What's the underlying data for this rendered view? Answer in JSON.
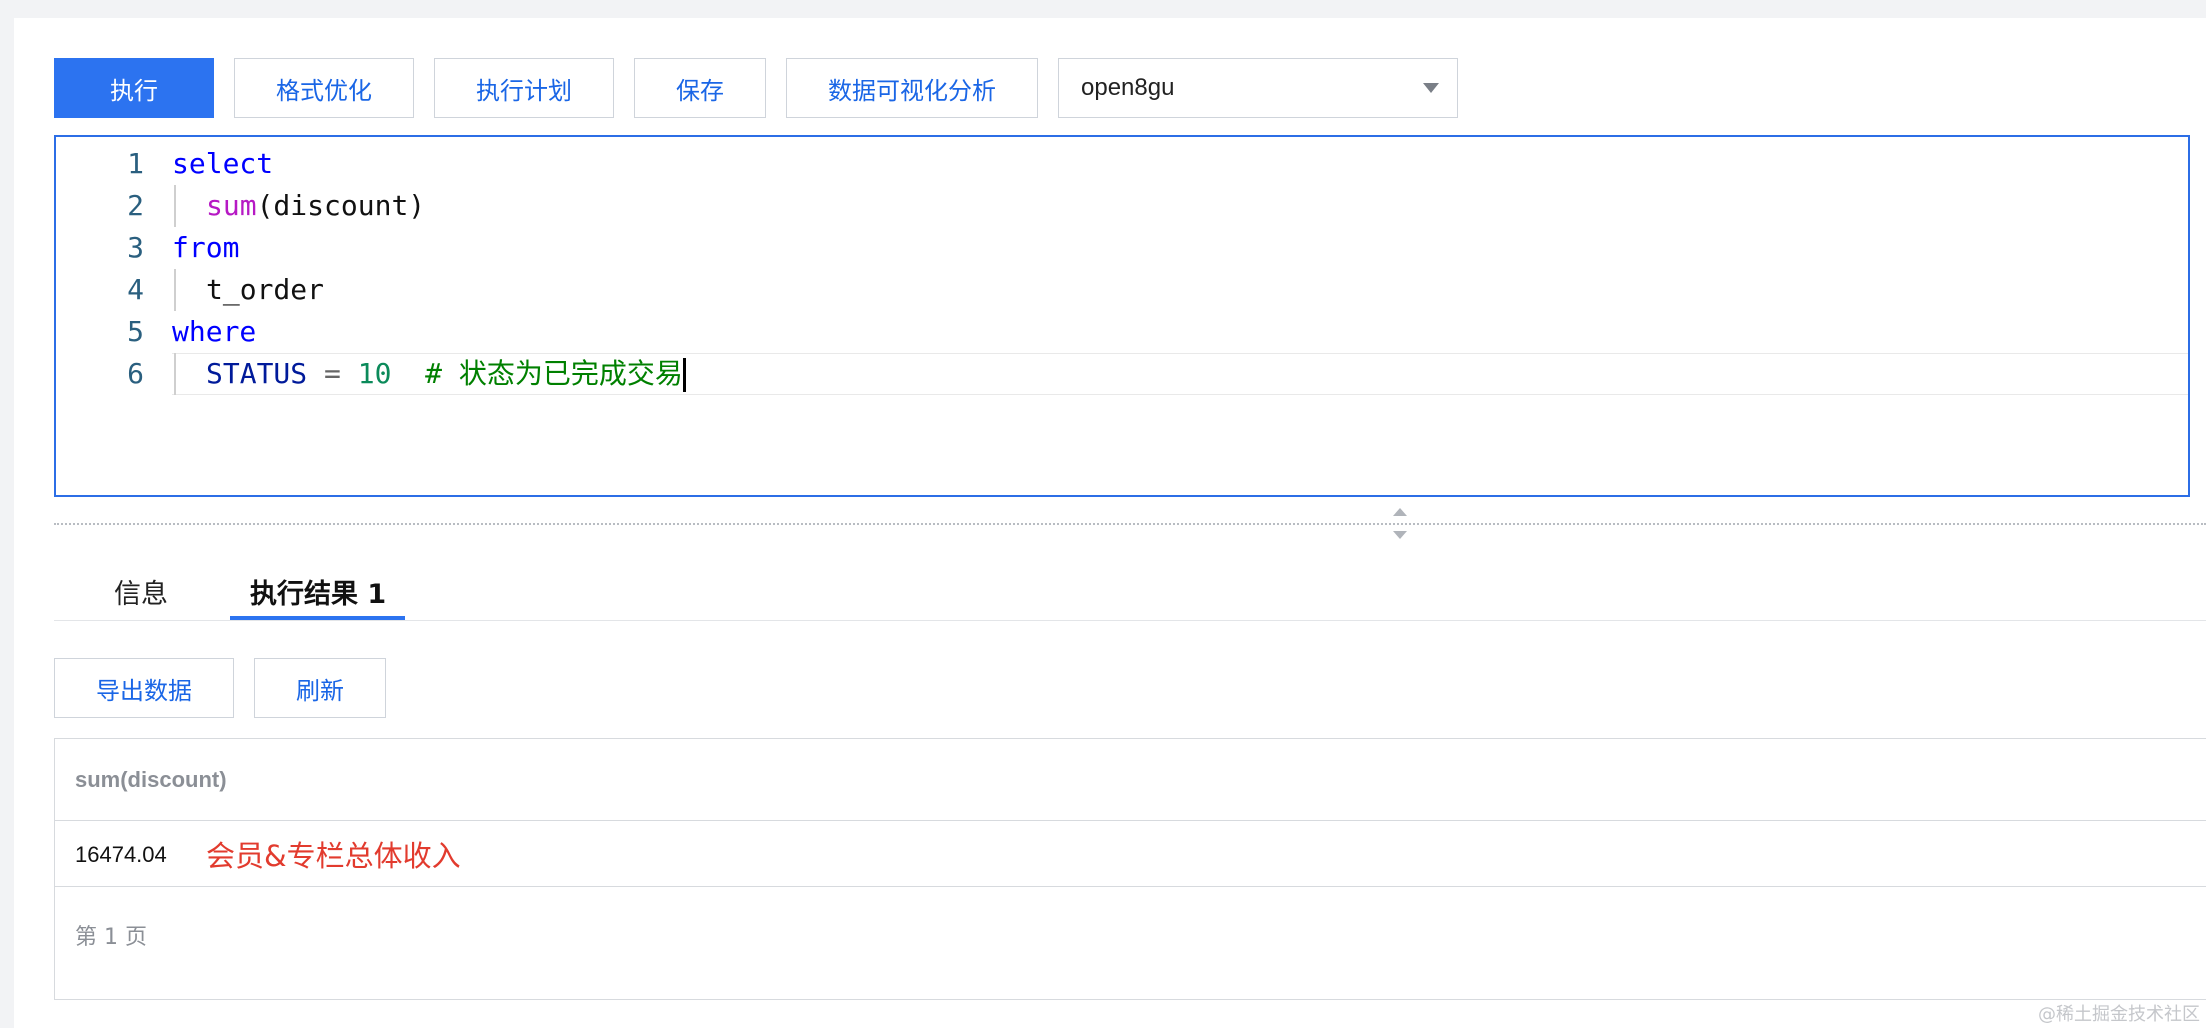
{
  "toolbar": {
    "execute_label": "执行",
    "format_label": "格式优化",
    "plan_label": "执行计划",
    "save_label": "保存",
    "visualize_label": "数据可视化分析",
    "database_selected": "open8gu"
  },
  "editor": {
    "lines": [
      {
        "number": "1",
        "tokens": [
          {
            "t": "select",
            "c": "kw"
          }
        ]
      },
      {
        "number": "2",
        "tokens": [
          {
            "t": "sum",
            "c": "fn"
          },
          {
            "t": "(discount)",
            "c": "tx"
          }
        ]
      },
      {
        "number": "3",
        "tokens": [
          {
            "t": "from",
            "c": "kw"
          }
        ]
      },
      {
        "number": "4",
        "tokens": [
          {
            "t": "t_order",
            "c": "tx"
          }
        ]
      },
      {
        "number": "5",
        "tokens": [
          {
            "t": "where",
            "c": "kw"
          }
        ]
      },
      {
        "number": "6",
        "tokens": [
          {
            "t": "STATUS",
            "c": "id"
          },
          {
            "t": " = ",
            "c": "op"
          },
          {
            "t": "10",
            "c": "num"
          },
          {
            "t": "  # 状态为已完成交易",
            "c": "cm"
          }
        ]
      }
    ]
  },
  "tabs": {
    "info_label": "信息",
    "result_label": "执行结果 1"
  },
  "results": {
    "export_label": "导出数据",
    "refresh_label": "刷新",
    "columns": [
      "sum(discount)"
    ],
    "rows": [
      [
        "16474.04"
      ]
    ],
    "annotation": "会员&专栏总体收入",
    "pager": "第 1 页"
  },
  "watermark": "@稀土掘金技术社区"
}
